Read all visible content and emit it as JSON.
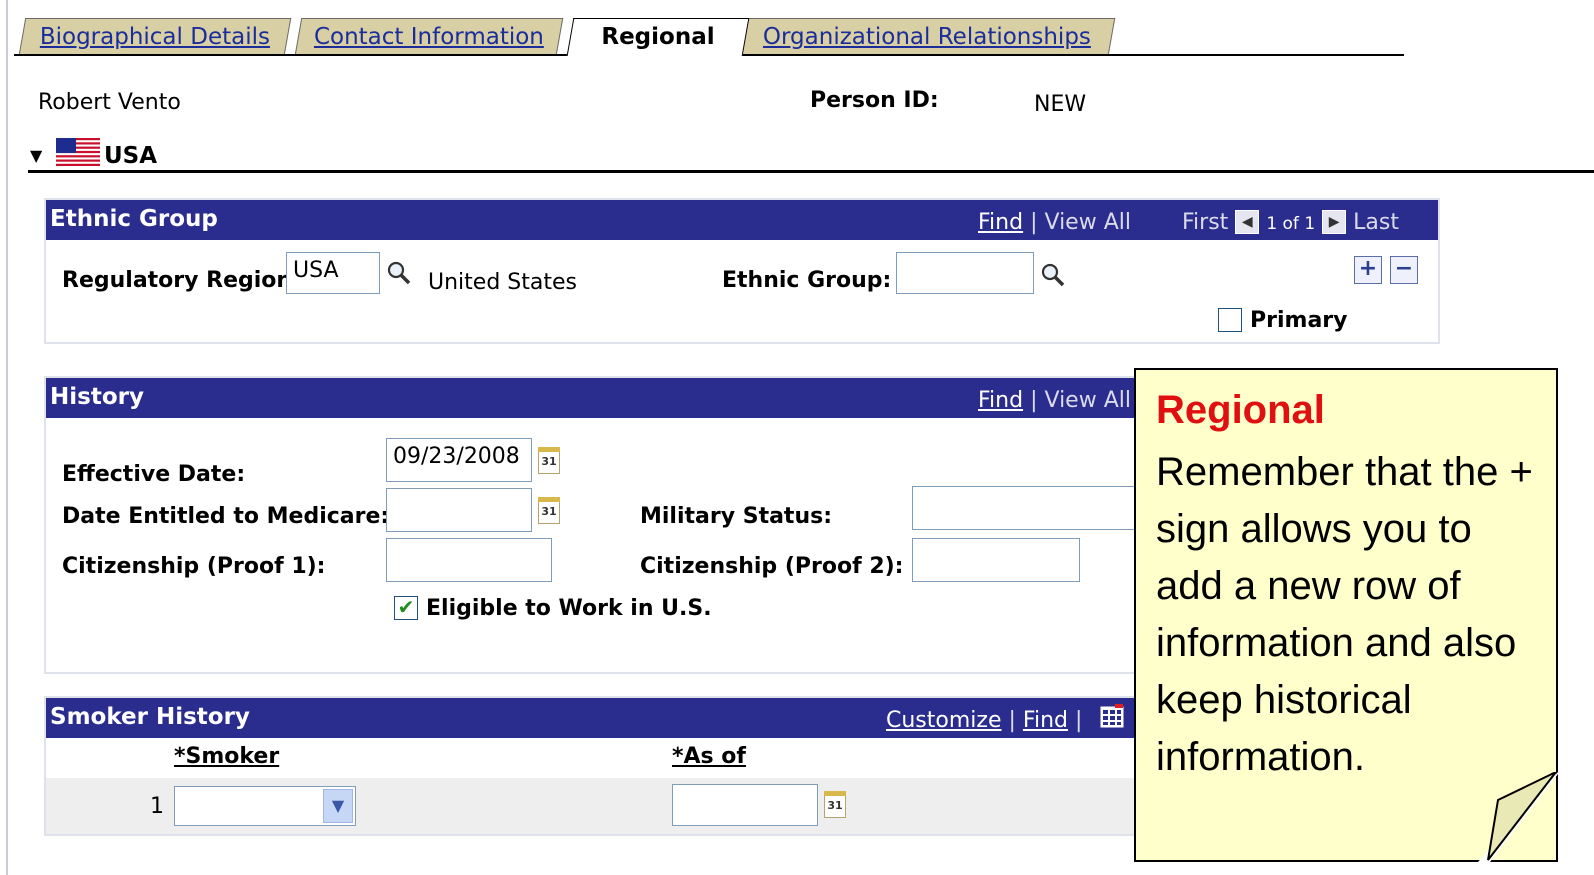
{
  "tabs": [
    {
      "label": "Biographical Details",
      "active": false
    },
    {
      "label": "Contact Information",
      "active": false
    },
    {
      "label": "Regional",
      "active": true
    },
    {
      "label": "Organizational Relationships",
      "active": false
    }
  ],
  "person": {
    "name": "Robert Vento",
    "id_label": "Person ID:",
    "id_value": "NEW"
  },
  "country": {
    "name": "USA"
  },
  "ethnic_group": {
    "title": "Ethnic Group",
    "find": "Find",
    "separator": "|",
    "view_all": "View All",
    "first": "First",
    "page_of": "1 of 1",
    "last": "Last",
    "regulatory_region_label": "Regulatory Region:",
    "regulatory_region_value": "USA",
    "region_description": "United States",
    "ethnic_group_label": "Ethnic Group:",
    "ethnic_group_value": "",
    "primary_label": "Primary",
    "add_symbol": "+",
    "remove_symbol": "−"
  },
  "history": {
    "title": "History",
    "find": "Find",
    "separator": "|",
    "view_all": "View All",
    "effective_date_label": "Effective Date:",
    "effective_date_value": "09/23/2008",
    "medicare_label": "Date Entitled to Medicare:",
    "medicare_value": "",
    "military_status_label": "Military Status:",
    "military_status_value": "",
    "citizenship1_label": "Citizenship (Proof 1):",
    "citizenship1_value": "",
    "citizenship2_label": "Citizenship (Proof 2):",
    "citizenship2_value": "",
    "eligible_label": "Eligible to Work in U.S.",
    "eligible_checked": true
  },
  "smoker_history": {
    "title": "Smoker History",
    "customize": "Customize",
    "separator": "|",
    "find": "Find",
    "separator2": "|",
    "smoker_header": "*Smoker",
    "as_of_header": "*As of",
    "row_number": "1",
    "smoker_value": "",
    "as_of_value": ""
  },
  "calendar_glyph": "31",
  "callout": {
    "title": "Regional",
    "body": "Remember that the + sign allows you to add a new row of information and also keep historical information."
  },
  "colors": {
    "header_bg": "#2b2d8e",
    "tab_bg": "#d9cfa5",
    "callout_bg": "#ffffcc",
    "callout_title": "#e01010",
    "link": "#1a2d9b"
  }
}
